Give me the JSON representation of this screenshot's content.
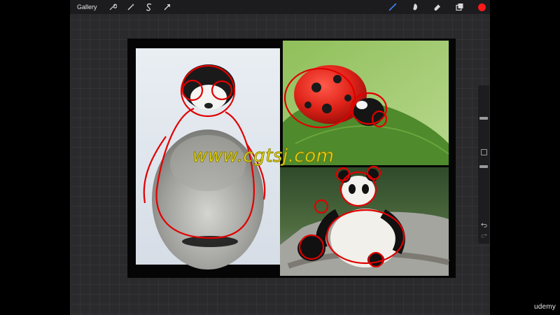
{
  "toolbar": {
    "gallery_label": "Gallery",
    "left_tools": [
      "wrench-icon",
      "magic-wand-icon",
      "selection-s-icon",
      "transform-arrow-icon"
    ],
    "right_tools": [
      "brush-icon",
      "smudge-icon",
      "eraser-icon",
      "layers-icon"
    ],
    "active_color": "#ff1a1a",
    "brush_color": "#3b82f6"
  },
  "canvas": {
    "photos": [
      "penguin-chick",
      "ladybug",
      "giant-panda"
    ],
    "sketch_color": "#e00000"
  },
  "sidebar": {
    "size_slider": 0.2,
    "opacity_slider": 0.15
  },
  "watermark": {
    "text": "www.cgtsj.com"
  },
  "brand": {
    "text": "udemy"
  }
}
